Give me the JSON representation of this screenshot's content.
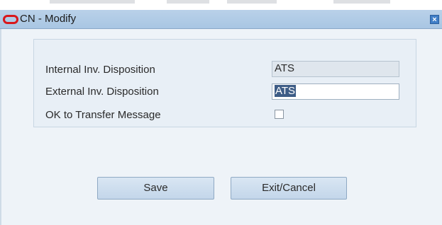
{
  "window": {
    "title": "CN - Modify",
    "close_glyph": "×",
    "icon": "oracle-icon"
  },
  "form": {
    "internal_disposition_label": "Internal Inv. Disposition",
    "internal_disposition_value": "ATS",
    "external_disposition_label": "External Inv. Disposition",
    "external_disposition_value": "ATS",
    "ok_transfer_label": "OK to Transfer Message",
    "ok_transfer_checked": false
  },
  "buttons": {
    "save_label": "Save",
    "exit_label": "Exit/Cancel"
  },
  "colors": {
    "titlebar": "#b9d1e9",
    "background": "#eef3f8",
    "selection": "#3d5c86",
    "oracle_red": "#d8171c"
  }
}
